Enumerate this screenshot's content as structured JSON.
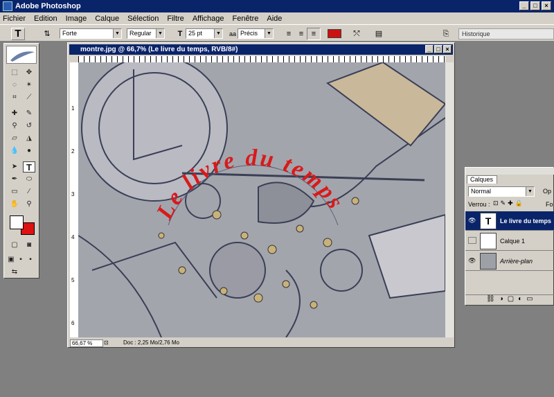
{
  "window": {
    "title": "Adobe Photoshop",
    "min": "_",
    "max": "□",
    "close": "×"
  },
  "menu": [
    "Fichier",
    "Edition",
    "Image",
    "Calque",
    "Sélection",
    "Filtre",
    "Affichage",
    "Fenêtre",
    "Aide"
  ],
  "options": {
    "font_family": "Forte",
    "font_style": "Regular",
    "font_size": "25 pt",
    "aa_label": "aa",
    "antialias": "Précis",
    "color": "#cc1111",
    "history_tab": "Historique"
  },
  "document": {
    "title": "montre.jpg @ 66,7% (Le livre du temps, RVB/8#)",
    "zoom": "66,67 %",
    "doc_info": "Doc : 2,25 Mo/2,76 Mo",
    "warped_text": "Le livre du temps",
    "text_color": "#d81a1a",
    "ruler_v": [
      "1",
      "2",
      "3",
      "4",
      "5",
      "6"
    ]
  },
  "layers": {
    "tab": "Calques",
    "blend": "Normal",
    "opacity_label": "Op",
    "lock_label": "Verrou :",
    "fill_label": "Fo",
    "items": [
      {
        "name": "Le livre du temps",
        "type": "text",
        "visible": true,
        "selected": true
      },
      {
        "name": "Calque 1",
        "type": "blank",
        "visible": false,
        "selected": false
      },
      {
        "name": "Arrière-plan",
        "type": "image",
        "visible": true,
        "selected": false
      }
    ]
  },
  "toolbox": {
    "fg_color": "#ffffff",
    "bg_color": "#dd1111"
  }
}
